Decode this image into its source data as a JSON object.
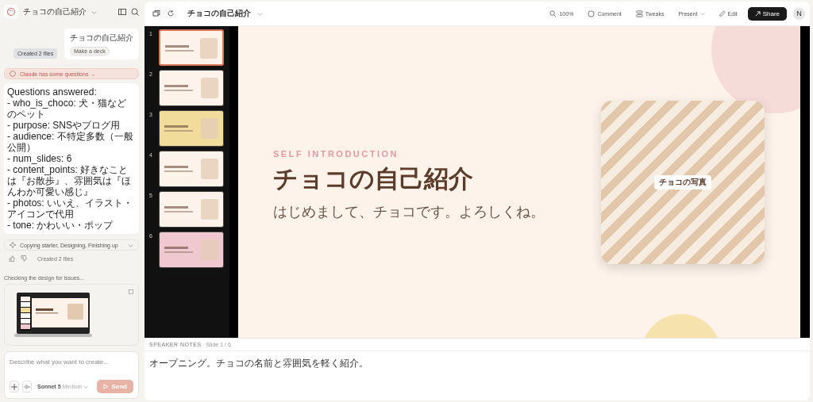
{
  "sidebar": {
    "project_title": "チョコの自己紹介",
    "user_message": {
      "text": "チョコの自己紹介",
      "chip": "Make a deck"
    },
    "tool_chip": "Created 2 files",
    "questions_banner": "Claude has some questions →",
    "answers": [
      "Questions answered:",
      "- who_is_choco: 犬・猫などのペット",
      "- purpose: SNSやブログ用",
      "- audience: 不特定多数（一般公開）",
      "- num_slides: 6",
      "- content_points: 好きなことは『お散歩』、雰囲気は『ほんわか可愛い感じ』",
      "- photos: いいえ、イラスト・アイコンで代用",
      "- tone: かわいい・ポップ"
    ],
    "progress": "Copying starter, Designing, Finishing up",
    "footer_note": "Created 2 files",
    "checking": "Checking the design for issues...",
    "composer": {
      "placeholder": "Describe what you want to create...",
      "model": "Sonnet 5",
      "effort": "Medium",
      "send": "Send"
    }
  },
  "toolbar": {
    "title": "チョコの自己紹介",
    "zoom": "100%",
    "comment": "Comment",
    "tweaks": "Tweaks",
    "present": "Present",
    "edit": "Edit",
    "share": "Share",
    "avatar": "N"
  },
  "thumbnails": [
    {
      "number": "1",
      "selected": true,
      "color": "#fdf3ea"
    },
    {
      "number": "2",
      "selected": false,
      "color": "#fdf3ea"
    },
    {
      "number": "3",
      "selected": false,
      "color": "#f1dc9c"
    },
    {
      "number": "4",
      "selected": false,
      "color": "#fdf3ea"
    },
    {
      "number": "5",
      "selected": false,
      "color": "#fdf3ea"
    },
    {
      "number": "6",
      "selected": false,
      "color": "#efc9cf"
    }
  ],
  "slide": {
    "eyebrow": "SELF INTRODUCTION",
    "title": "チョコの自己紹介",
    "subtitle": "はじめまして、チョコです。よろしくね。",
    "photo_label": "チョコの写真"
  },
  "notes": {
    "heading": "SPEAKER NOTES",
    "slide_indicator": "Slide 1 / 6",
    "text": "オープニング。チョコの名前と雰囲気を軽く紹介。"
  }
}
